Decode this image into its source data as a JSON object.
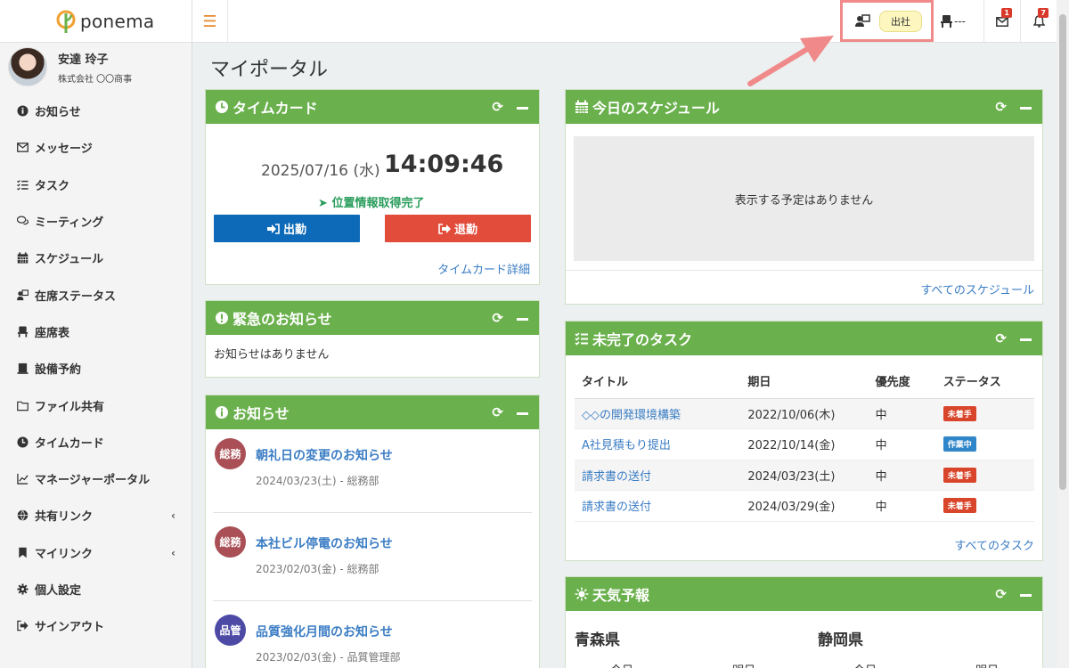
{
  "brand": {
    "name": "ponema"
  },
  "user": {
    "name": "安達 玲子",
    "company": "株式会社 〇〇商事"
  },
  "nav": [
    {
      "label": "お知らせ",
      "icon": "info-circle-icon"
    },
    {
      "label": "メッセージ",
      "icon": "envelope-icon"
    },
    {
      "label": "タスク",
      "icon": "tasks-icon"
    },
    {
      "label": "ミーティング",
      "icon": "chat-bubbles-icon"
    },
    {
      "label": "スケジュール",
      "icon": "calendar-icon"
    },
    {
      "label": "在席ステータス",
      "icon": "person-desk-icon"
    },
    {
      "label": "座席表",
      "icon": "chair-icon"
    },
    {
      "label": "設備予約",
      "icon": "building-icon"
    },
    {
      "label": "ファイル共有",
      "icon": "folder-icon"
    },
    {
      "label": "タイムカード",
      "icon": "clock-icon"
    },
    {
      "label": "マネージャーポータル",
      "icon": "chart-line-icon"
    },
    {
      "label": "共有リンク",
      "icon": "globe-icon",
      "chevron": "‹"
    },
    {
      "label": "マイリンク",
      "icon": "bookmark-icon",
      "chevron": "‹"
    },
    {
      "label": "個人設定",
      "icon": "gear-icon"
    },
    {
      "label": "サインアウト",
      "icon": "sign-out-icon"
    }
  ],
  "topbar": {
    "presence_label": "出社",
    "seat_label": "---",
    "mail_count": "1",
    "notification_count": "7"
  },
  "page": {
    "title": "マイポータル"
  },
  "timecard": {
    "title": "タイムカード",
    "date": "2025/07/16 (水)",
    "time": "14:09:46",
    "location_status": "位置情報取得完了",
    "clock_in_label": "出勤",
    "clock_out_label": "退勤",
    "detail_link": "タイムカード詳細"
  },
  "urgent": {
    "title": "緊急のお知らせ",
    "empty_text": "お知らせはありません"
  },
  "news": {
    "title": "お知らせ",
    "items": [
      {
        "badge": "総務",
        "badge_color": "#a94f55",
        "title": "朝礼日の変更のお知らせ",
        "meta": "2024/03/23(土) - 総務部"
      },
      {
        "badge": "総務",
        "badge_color": "#a94f55",
        "title": "本社ビル停電のお知らせ",
        "meta": "2023/02/03(金) - 総務部"
      },
      {
        "badge": "品管",
        "badge_color": "#4d4aa6",
        "title": "品質強化月間のお知らせ",
        "meta": "2023/02/03(金) - 品質管理部"
      }
    ]
  },
  "schedule": {
    "title": "今日のスケジュール",
    "empty_text": "表示する予定はありません",
    "all_link": "すべてのスケジュール"
  },
  "tasks": {
    "title": "未完了のタスク",
    "columns": [
      "タイトル",
      "期日",
      "優先度",
      "ステータス"
    ],
    "rows": [
      {
        "title": "◇◇の開発環境構築",
        "due": "2022/10/06(木)",
        "priority": "中",
        "status": "未着手",
        "status_color": "#d9452b"
      },
      {
        "title": "A社見積もり提出",
        "due": "2022/10/14(金)",
        "priority": "中",
        "status": "作業中",
        "status_color": "#2f86c8"
      },
      {
        "title": "請求書の送付",
        "due": "2024/03/23(土)",
        "priority": "中",
        "status": "未着手",
        "status_color": "#d9452b"
      },
      {
        "title": "請求書の送付",
        "due": "2024/03/29(金)",
        "priority": "中",
        "status": "未着手",
        "status_color": "#d9452b"
      }
    ],
    "all_link": "すべてのタスク"
  },
  "weather": {
    "title": "天気予報",
    "regions": [
      {
        "name": "青森県",
        "days": [
          "今日",
          "明日"
        ]
      },
      {
        "name": "静岡県",
        "days": [
          "今日",
          "明日"
        ]
      }
    ]
  },
  "colors": {
    "panel_header": "#6ab04c",
    "link": "#3b7dc4",
    "clock_in": "#0d6ab8",
    "clock_out": "#e24c3b",
    "highlight": "#f08a8a"
  }
}
